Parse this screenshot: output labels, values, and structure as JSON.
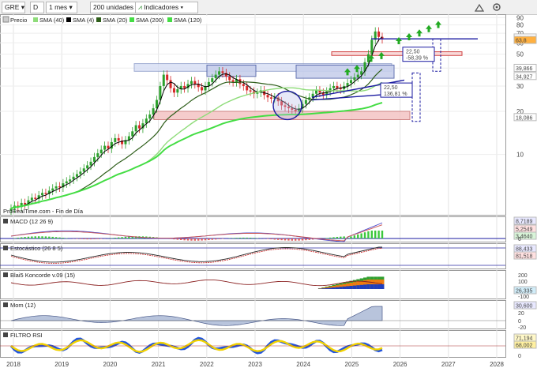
{
  "toolbar": {
    "symbol": "GRE",
    "d_button": "D",
    "timeframe": "1 mes",
    "units": "200 unidades",
    "indicators": "Indicadores"
  },
  "legend": {
    "price": "Precio",
    "sma40": "SMA (40)",
    "sma4": "SMA (4)",
    "sma20": "SMA (20)",
    "sma200": "SMA (200)",
    "sma120": "SMA (120)"
  },
  "source_label": "ProRealTime.com - Fin de Día",
  "colors": {
    "up": "#2ca02c",
    "down": "#d62728",
    "sma4": "#000000",
    "sma20": "#2e5e1a",
    "sma40": "#8fdc7a",
    "sma120": "#44dd44",
    "trend": "#1a1aa0",
    "macd_hist": "#3cc83c",
    "stoch": "#cc3333",
    "koncorde_blue": "#1f3fbf",
    "koncorde_orange": "#f07a10",
    "koncorde_green": "#30a030",
    "mom_fill": "#b8c4dc",
    "rsi_yellow": "#f2d200",
    "rsi_blue": "#2255dd"
  },
  "annotations": {
    "box1_top": "22,50",
    "box1_bottom": "-58,39 %",
    "box2_top": "22,50",
    "box2_bottom": "136,81 %"
  },
  "chart_data": [
    {
      "type": "candlestick",
      "title": "GRE",
      "x": [
        "2018",
        "2019",
        "2020",
        "2021",
        "2022",
        "2023",
        "2024",
        "2025",
        "2026",
        "2027",
        "2028"
      ],
      "y_scale": "log",
      "y_ticks": [
        10,
        20,
        30,
        40,
        50,
        60,
        70,
        80,
        90
      ],
      "price_labels": {
        "last": "63,8",
        "sma4": "65,025",
        "sma20": "39,866",
        "sma40": "34,927",
        "sma120": "18,086"
      },
      "closes": [
        4.2,
        4.4,
        4.3,
        4.6,
        4.5,
        4.8,
        5.0,
        4.9,
        5.2,
        5.4,
        5.3,
        5.6,
        5.8,
        6.0,
        5.9,
        6.3,
        6.5,
        6.7,
        7.0,
        7.3,
        7.6,
        8.0,
        8.4,
        8.9,
        9.6,
        10.2,
        10.8,
        11.5,
        11.0,
        12.2,
        13.0,
        12.5,
        11.8,
        12.6,
        13.4,
        14.5,
        16.0,
        15.2,
        16.5,
        17.8,
        19.0,
        21.0,
        24.0,
        30.0,
        36.0,
        33.0,
        29.0,
        27.0,
        28.5,
        30.0,
        29.0,
        31.0,
        32.5,
        31.0,
        29.5,
        28.0,
        30.0,
        32.0,
        34.0,
        36.0,
        38.0,
        37.0,
        35.0,
        33.0,
        32.0,
        33.5,
        31.0,
        30.0,
        28.0,
        27.5,
        26.5,
        27.0,
        28.0,
        26.0,
        25.0,
        24.5,
        25.0,
        23.5,
        22.0,
        21.5,
        21.0,
        20.5,
        20.0,
        21.0,
        22.5,
        24.0,
        25.0,
        26.5,
        28.0,
        27.0,
        26.0,
        27.5,
        29.0,
        30.0,
        29.0,
        28.5,
        30.0,
        31.5,
        33.0,
        34.5,
        36.0,
        38.0,
        44.0,
        50.0,
        63.0,
        72.0,
        66.0,
        63.8
      ],
      "projections": {
        "arrows_to": 78,
        "upper_target": 64,
        "lower_target": 50
      }
    },
    {
      "type": "line",
      "title": "MACD (12 26 9)",
      "price_labels": [
        "8,7189",
        "5,2549",
        "3,4640"
      ],
      "y_ticks": [
        0
      ]
    },
    {
      "type": "line",
      "title": "Estocástico (26 8 5)",
      "price_labels": [
        "88,433",
        "81,518"
      ]
    },
    {
      "type": "area",
      "title": "Blai5 Koncorde v.09 (15)",
      "price_labels": [
        "26,335"
      ],
      "y_ticks": [
        -100,
        0,
        100,
        200
      ]
    },
    {
      "type": "area",
      "title": "Mom (12)",
      "price_labels": [
        "30,600"
      ],
      "y_ticks": [
        -20,
        0,
        20,
        40
      ]
    },
    {
      "type": "line",
      "title": "FILTRO RSI",
      "price_labels": [
        "71,194",
        "68,002"
      ],
      "y_ticks": [
        0,
        50
      ]
    }
  ]
}
